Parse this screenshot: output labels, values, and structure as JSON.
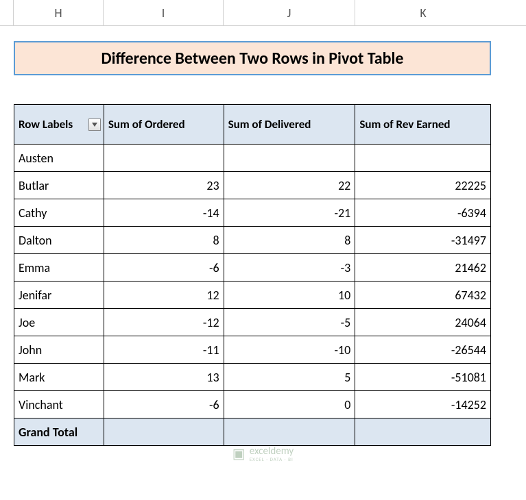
{
  "columns": {
    "H": "H",
    "I": "I",
    "J": "J",
    "K": "K"
  },
  "title": "Difference Between Two Rows in Pivot Table",
  "pivot": {
    "headers": {
      "row_labels": "Row Labels",
      "col1": "Sum of Ordered",
      "col2": "Sum of Delivered",
      "col3": "Sum of Rev Earned"
    },
    "rows": [
      {
        "label": "Austen",
        "ordered": "",
        "delivered": "",
        "rev": ""
      },
      {
        "label": "Butlar",
        "ordered": "23",
        "delivered": "22",
        "rev": "22225"
      },
      {
        "label": "Cathy",
        "ordered": "-14",
        "delivered": "-21",
        "rev": "-6394"
      },
      {
        "label": "Dalton",
        "ordered": "8",
        "delivered": "8",
        "rev": "-31497"
      },
      {
        "label": "Emma",
        "ordered": "-6",
        "delivered": "-3",
        "rev": "21462"
      },
      {
        "label": "Jenifar",
        "ordered": "12",
        "delivered": "10",
        "rev": "67432"
      },
      {
        "label": "Joe",
        "ordered": "-12",
        "delivered": "-5",
        "rev": "24064"
      },
      {
        "label": "John",
        "ordered": "-11",
        "delivered": "-10",
        "rev": "-26544"
      },
      {
        "label": "Mark",
        "ordered": "13",
        "delivered": "5",
        "rev": "-51081"
      },
      {
        "label": "Vinchant",
        "ordered": "-6",
        "delivered": "0",
        "rev": "-14252"
      }
    ],
    "grand_total_label": "Grand Total"
  },
  "watermark": {
    "main": "exceldemy",
    "sub": "EXCEL · DATA · BI"
  }
}
